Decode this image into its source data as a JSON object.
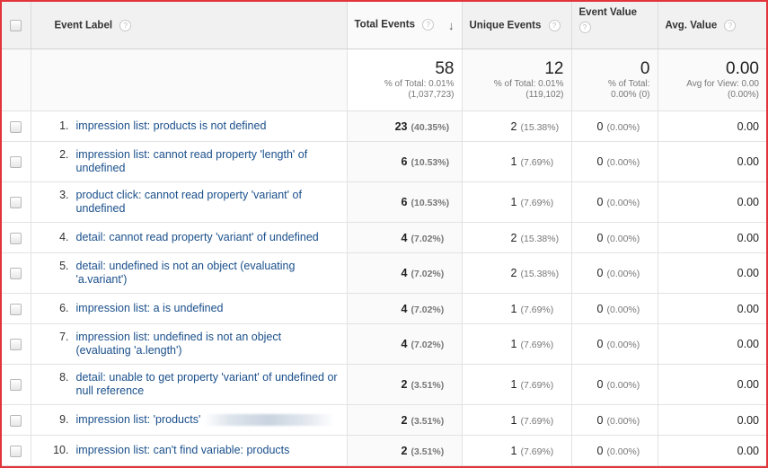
{
  "headers": {
    "event_label": "Event Label",
    "total_events": "Total Events",
    "unique_events": "Unique Events",
    "event_value": "Event Value",
    "avg_value": "Avg. Value",
    "help_glyph": "?",
    "sort_glyph": "↓"
  },
  "summary": {
    "total_events": {
      "value": "58",
      "line1": "% of Total: 0.01%",
      "line2": "(1,037,723)"
    },
    "unique_events": {
      "value": "12",
      "line1": "% of Total: 0.01%",
      "line2": "(119,102)"
    },
    "event_value": {
      "value": "0",
      "line1": "% of Total:",
      "line2": "0.00% (0)"
    },
    "avg_value": {
      "value": "0.00",
      "line1": "Avg for View: 0.00",
      "line2": "(0.00%)"
    }
  },
  "rows": [
    {
      "num": "1.",
      "label": "impression list: products is not defined",
      "total": "23",
      "total_pct": "(40.35%)",
      "unique": "2",
      "unique_pct": "(15.38%)",
      "value": "0",
      "value_pct": "(0.00%)",
      "avg": "0.00"
    },
    {
      "num": "2.",
      "label": "impression list: cannot read property 'length' of undefined",
      "total": "6",
      "total_pct": "(10.53%)",
      "unique": "1",
      "unique_pct": "(7.69%)",
      "value": "0",
      "value_pct": "(0.00%)",
      "avg": "0.00"
    },
    {
      "num": "3.",
      "label": "product click: cannot read property 'variant' of undefined",
      "total": "6",
      "total_pct": "(10.53%)",
      "unique": "1",
      "unique_pct": "(7.69%)",
      "value": "0",
      "value_pct": "(0.00%)",
      "avg": "0.00"
    },
    {
      "num": "4.",
      "label": "detail: cannot read property 'variant' of undefined",
      "total": "4",
      "total_pct": "(7.02%)",
      "unique": "2",
      "unique_pct": "(15.38%)",
      "value": "0",
      "value_pct": "(0.00%)",
      "avg": "0.00"
    },
    {
      "num": "5.",
      "label": "detail: undefined is not an object (evaluating 'a.variant')",
      "total": "4",
      "total_pct": "(7.02%)",
      "unique": "2",
      "unique_pct": "(15.38%)",
      "value": "0",
      "value_pct": "(0.00%)",
      "avg": "0.00"
    },
    {
      "num": "6.",
      "label": "impression list: a is undefined",
      "total": "4",
      "total_pct": "(7.02%)",
      "unique": "1",
      "unique_pct": "(7.69%)",
      "value": "0",
      "value_pct": "(0.00%)",
      "avg": "0.00"
    },
    {
      "num": "7.",
      "label": "impression list: undefined is not an object (evaluating 'a.length')",
      "total": "4",
      "total_pct": "(7.02%)",
      "unique": "1",
      "unique_pct": "(7.69%)",
      "value": "0",
      "value_pct": "(0.00%)",
      "avg": "0.00"
    },
    {
      "num": "8.",
      "label": "detail: unable to get property 'variant' of undefined or null reference",
      "total": "2",
      "total_pct": "(3.51%)",
      "unique": "1",
      "unique_pct": "(7.69%)",
      "value": "0",
      "value_pct": "(0.00%)",
      "avg": "0.00"
    },
    {
      "num": "9.",
      "label": "impression list: 'products'",
      "blurred": true,
      "total": "2",
      "total_pct": "(3.51%)",
      "unique": "1",
      "unique_pct": "(7.69%)",
      "value": "0",
      "value_pct": "(0.00%)",
      "avg": "0.00"
    },
    {
      "num": "10.",
      "label": "impression list: can't find variable: products",
      "total": "2",
      "total_pct": "(3.51%)",
      "unique": "1",
      "unique_pct": "(7.69%)",
      "value": "0",
      "value_pct": "(0.00%)",
      "avg": "0.00"
    }
  ]
}
